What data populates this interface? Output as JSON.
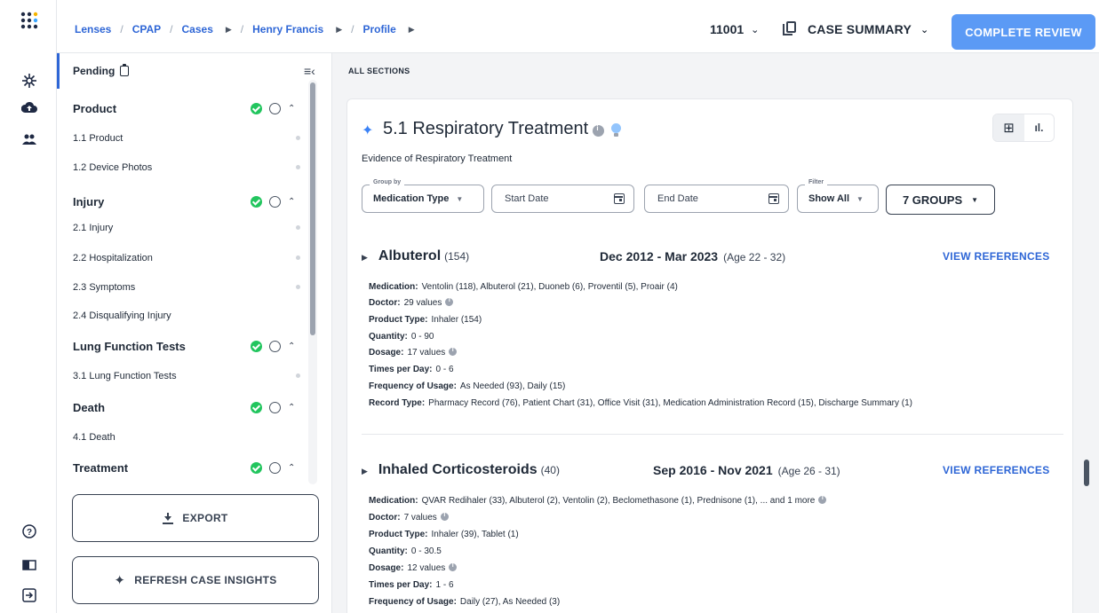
{
  "topbar": {
    "breadcrumbs": [
      "Lenses",
      "CPAP",
      "Cases",
      "Henry Francis",
      "Profile"
    ],
    "case_id": "11001",
    "case_summary": "CASE SUMMARY",
    "complete_review": "COMPLETE REVIEW"
  },
  "sidebar": {
    "pending_label": "Pending",
    "sections": [
      {
        "title": "Product",
        "items": [
          "1.1 Product",
          "1.2 Device Photos"
        ]
      },
      {
        "title": "Injury",
        "items": [
          "2.1 Injury",
          "2.2 Hospitalization",
          "2.3 Symptoms",
          "2.4 Disqualifying Injury"
        ]
      },
      {
        "title": "Lung Function Tests",
        "items": [
          "3.1 Lung Function Tests"
        ]
      },
      {
        "title": "Death",
        "items": [
          "4.1 Death"
        ]
      },
      {
        "title": "Treatment",
        "items": []
      }
    ],
    "export_label": "EXPORT",
    "refresh_label": "REFRESH CASE INSIGHTS"
  },
  "main": {
    "all_sections": "ALL SECTIONS",
    "card": {
      "title": "5.1 Respiratory Treatment",
      "subtitle": "Evidence of Respiratory Treatment",
      "filters": {
        "group_by_label": "Group by",
        "group_by_value": "Medication Type",
        "start_date_placeholder": "Start Date",
        "end_date_placeholder": "End Date",
        "filter_label": "Filter",
        "filter_value": "Show All",
        "groups": "7 GROUPS"
      },
      "view_references": "VIEW REFERENCES",
      "groups": [
        {
          "name": "Albuterol",
          "count": "(154)",
          "range": "Dec 2012 - Mar 2023",
          "age": "(Age 22 - 32)",
          "rows": [
            {
              "label": "Medication:",
              "value": "Ventolin (118),  Albuterol (21),  Duoneb (6),  Proventil (5),  Proair (4)"
            },
            {
              "label": "Doctor:",
              "value": "29 values"
            },
            {
              "label": "Product Type:",
              "value": "Inhaler (154)"
            },
            {
              "label": "Quantity:",
              "value": "0 - 90"
            },
            {
              "label": "Dosage:",
              "value": "17 values"
            },
            {
              "label": "Times per Day:",
              "value": "0 - 6"
            },
            {
              "label": "Frequency of Usage:",
              "value": "As Needed (93),  Daily (15)"
            },
            {
              "label": "Record Type:",
              "value": "Pharmacy Record (76),  Patient Chart (31),  Office Visit (31),  Medication Administration Record (15),  Discharge Summary (1)"
            }
          ]
        },
        {
          "name": "Inhaled Corticosteroids",
          "count": "(40)",
          "range": "Sep 2016 - Nov 2021",
          "age": "(Age 26 - 31)",
          "rows": [
            {
              "label": "Medication:",
              "value": "QVAR Redihaler (33),  Albuterol (2),  Ventolin (2),  Beclomethasone (1),  Prednisone (1),  ... and 1 more"
            },
            {
              "label": "Doctor:",
              "value": "7 values"
            },
            {
              "label": "Product Type:",
              "value": "Inhaler (39),  Tablet (1)"
            },
            {
              "label": "Quantity:",
              "value": "0 - 30.5"
            },
            {
              "label": "Dosage:",
              "value": "12 values"
            },
            {
              "label": "Times per Day:",
              "value": "1 - 6"
            },
            {
              "label": "Frequency of Usage:",
              "value": "Daily (27),  As Needed (3)"
            }
          ]
        }
      ]
    }
  },
  "colors": {
    "accent": "#2e66d6",
    "primary_button": "#5b9af5",
    "success": "#22c55e"
  }
}
